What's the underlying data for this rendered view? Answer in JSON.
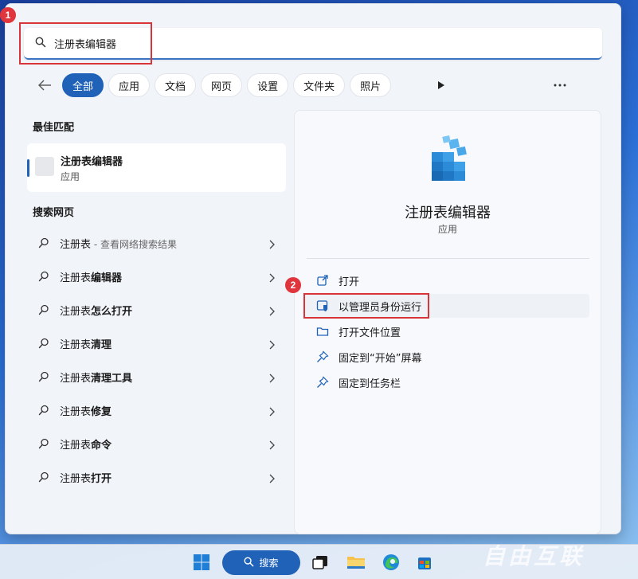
{
  "search": {
    "query": "注册表编辑器"
  },
  "markers": [
    "1",
    "2"
  ],
  "filters": {
    "tabs": [
      "全部",
      "应用",
      "文档",
      "网页",
      "设置",
      "文件夹",
      "照片"
    ],
    "active": "全部"
  },
  "best_match": {
    "title": "最佳匹配",
    "name": "注册表编辑器",
    "type": "应用"
  },
  "web_search": {
    "title": "搜索网页",
    "items": [
      {
        "prefix": "注册表",
        "bold": "",
        "suffix": " - 查看网络搜索结果"
      },
      {
        "prefix": "注册表",
        "bold": "编辑器",
        "suffix": ""
      },
      {
        "prefix": "注册表",
        "bold": "怎么打开",
        "suffix": ""
      },
      {
        "prefix": "注册表",
        "bold": "清理",
        "suffix": ""
      },
      {
        "prefix": "注册表",
        "bold": "清理工具",
        "suffix": ""
      },
      {
        "prefix": "注册表",
        "bold": "修复",
        "suffix": ""
      },
      {
        "prefix": "注册表",
        "bold": "命令",
        "suffix": ""
      },
      {
        "prefix": "注册表",
        "bold": "打开",
        "suffix": ""
      }
    ]
  },
  "detail": {
    "name": "注册表编辑器",
    "type": "应用",
    "actions": [
      {
        "label": "打开",
        "icon": "open-external-icon"
      },
      {
        "label": "以管理员身份运行",
        "icon": "admin-shield-icon"
      },
      {
        "label": "打开文件位置",
        "icon": "folder-icon"
      },
      {
        "label": "固定到“开始”屏幕",
        "icon": "pin-icon"
      },
      {
        "label": "固定到任务栏",
        "icon": "pin-icon"
      }
    ]
  },
  "taskbar": {
    "search_label": "搜索",
    "icons": [
      "windows-start-icon",
      "search-icon",
      "task-view-icon",
      "file-explorer-icon",
      "edge-icon",
      "store-icon"
    ]
  },
  "colors": {
    "accent": "#1f62b8",
    "highlight_red": "#d9343a",
    "marker_red": "#e0353c"
  },
  "watermark": "自由互联"
}
